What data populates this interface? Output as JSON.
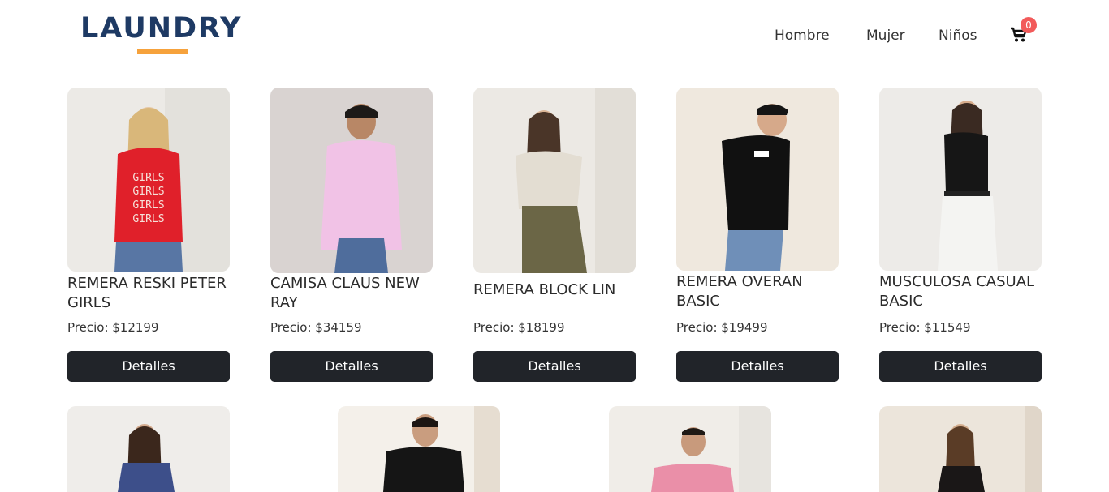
{
  "brand": {
    "name": "LAUNDRY",
    "accent_color": "#f6a23c",
    "text_color": "#1e3a64"
  },
  "nav": {
    "items": [
      {
        "label": "Hombre"
      },
      {
        "label": "Mujer"
      },
      {
        "label": "Niños"
      }
    ],
    "cart": {
      "count": "0",
      "icon": "cart-icon",
      "badge_color": "#f25a5a"
    }
  },
  "products": [
    {
      "title": "REMERA RESKI PETER GIRLS",
      "price": "Precio: $12199",
      "button": "Detalles"
    },
    {
      "title": "CAMISA CLAUS NEW RAY",
      "price": "Precio: $34159",
      "button": "Detalles"
    },
    {
      "title": "REMERA BLOCK LIN",
      "price": "Precio: $18199",
      "button": "Detalles"
    },
    {
      "title": "REMERA OVERAN BASIC",
      "price": "Precio: $19499",
      "button": "Detalles"
    },
    {
      "title": "MUSCULOSA CASUAL BASIC",
      "price": "Precio: $11549",
      "button": "Detalles"
    }
  ],
  "button_color": "#212429"
}
